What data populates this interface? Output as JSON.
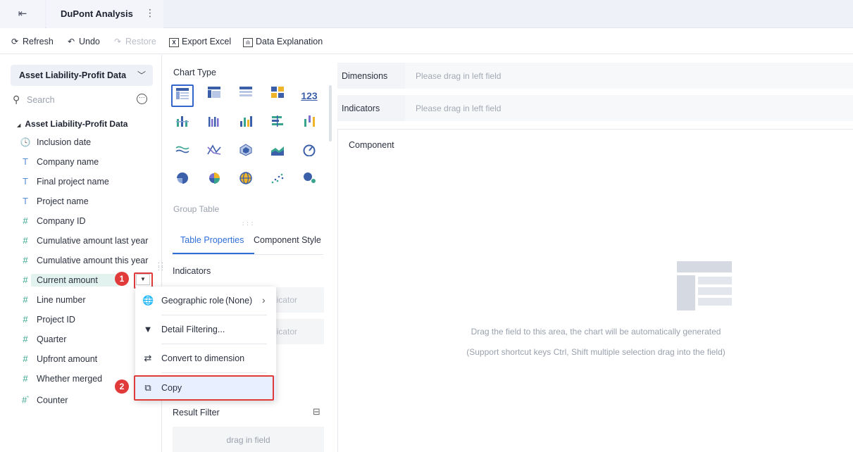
{
  "header": {
    "exit_icon": "exit-icon",
    "tab_title": "DuPont Analysis",
    "more_icon": "⋮"
  },
  "toolbar": {
    "refresh": "Refresh",
    "undo": "Undo",
    "restore": "Restore",
    "export_excel": "Export Excel",
    "data_explanation": "Data Explanation"
  },
  "sidebar": {
    "dataset_select": "Asset Liability-Profit Data",
    "search_placeholder": "Search",
    "tree_root": "Asset Liability-Profit Data",
    "fields": [
      {
        "label": "Inclusion date",
        "type": "date",
        "icon": "clock-icon"
      },
      {
        "label": "Company name",
        "type": "text",
        "icon": "T"
      },
      {
        "label": "Final project name",
        "type": "text",
        "icon": "T"
      },
      {
        "label": "Project name",
        "type": "text",
        "icon": "T"
      },
      {
        "label": "Company ID",
        "type": "number",
        "icon": "#"
      },
      {
        "label": "Cumulative amount last year",
        "type": "number",
        "icon": "#"
      },
      {
        "label": "Cumulative amount this year",
        "type": "number",
        "icon": "#"
      },
      {
        "label": "Current amount",
        "type": "number",
        "icon": "#",
        "selected": true
      },
      {
        "label": "Line number",
        "type": "number",
        "icon": "#"
      },
      {
        "label": "Project ID",
        "type": "number",
        "icon": "#"
      },
      {
        "label": "Quarter",
        "type": "number",
        "icon": "#"
      },
      {
        "label": "Upfront amount",
        "type": "number",
        "icon": "#"
      },
      {
        "label": "Whether merged",
        "type": "number",
        "icon": "#"
      },
      {
        "label": "Counter",
        "type": "number",
        "icon": "#*"
      }
    ]
  },
  "annotations": {
    "step1": "1",
    "step2": "2",
    "highlight_color": "#e03a3a"
  },
  "context_menu": {
    "geographic_role": "Geographic role",
    "geographic_role_value": "(None)",
    "detail_filtering": "Detail Filtering...",
    "convert": "Convert to dimension",
    "copy": "Copy"
  },
  "middle": {
    "chart_type_title": "Chart Type",
    "chart_types": [
      "group-table",
      "cross-table",
      "detail-table",
      "kpi-card",
      "number-123",
      "stacked-bar",
      "multi-bar",
      "column",
      "horizontal-bar",
      "range-bar",
      "wave",
      "funnel",
      "radar",
      "area",
      "gauge",
      "pie",
      "rose",
      "globe",
      "scatter",
      "bubble"
    ],
    "number_glyph": "123",
    "group_table_label": "Group Table",
    "tabs": [
      "Table Properties",
      "Component Style"
    ],
    "indicators_label": "Indicators",
    "slot_placeholder": "dicator",
    "slot_placeholder2": "dicator",
    "result_filter": "Result Filter",
    "drag_in_field": "drag in field"
  },
  "right": {
    "dimensions_label": "Dimensions",
    "dimensions_placeholder": "Please drag in left field",
    "indicators_label": "Indicators",
    "indicators_placeholder": "Please drag in left field",
    "component_label": "Component",
    "hint_main": "Drag the field to this area, the chart will be automatically generated",
    "hint_sub": "(Support shortcut keys Ctrl, Shift multiple selection drag into the field)"
  },
  "colors": {
    "accent": "#2f6fd8",
    "number_field": "#3aa58f",
    "text_field": "#5a8fd8"
  }
}
